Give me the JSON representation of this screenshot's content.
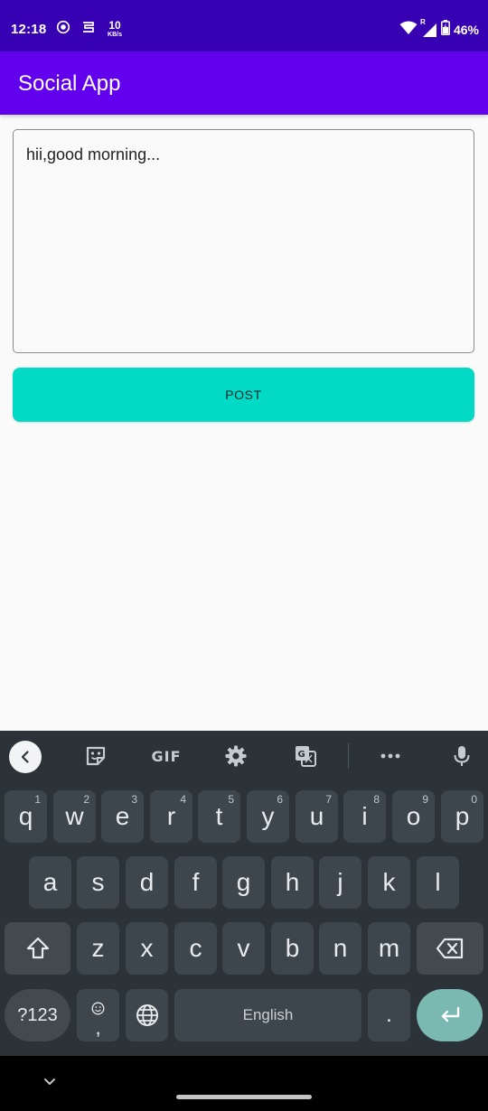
{
  "status_bar": {
    "time": "12:18",
    "net_speed_value": "10",
    "net_speed_unit": "KB/s",
    "roaming": "R",
    "battery": "46%"
  },
  "app_bar": {
    "title": "Social App"
  },
  "post_input": {
    "value": "hii,good morning..."
  },
  "post_button": {
    "label": "POST"
  },
  "keyboard": {
    "toolbar": {
      "gif_label": "GIF"
    },
    "row1": [
      {
        "key": "q",
        "hint": "1"
      },
      {
        "key": "w",
        "hint": "2"
      },
      {
        "key": "e",
        "hint": "3"
      },
      {
        "key": "r",
        "hint": "4"
      },
      {
        "key": "t",
        "hint": "5"
      },
      {
        "key": "y",
        "hint": "6"
      },
      {
        "key": "u",
        "hint": "7"
      },
      {
        "key": "i",
        "hint": "8"
      },
      {
        "key": "o",
        "hint": "9"
      },
      {
        "key": "p",
        "hint": "0"
      }
    ],
    "row2": [
      "a",
      "s",
      "d",
      "f",
      "g",
      "h",
      "j",
      "k",
      "l"
    ],
    "row3": [
      "z",
      "x",
      "c",
      "v",
      "b",
      "n",
      "m"
    ],
    "symbols_label": "?123",
    "comma_label": ",",
    "space_label": "English",
    "period_label": ".",
    "colors": {
      "background": "#2b3238",
      "key": "#3d464c",
      "enter": "#7ab8b2"
    }
  },
  "colors": {
    "status_bar": "#3700b3",
    "app_bar": "#6200ee",
    "post_button": "#03dac5"
  }
}
